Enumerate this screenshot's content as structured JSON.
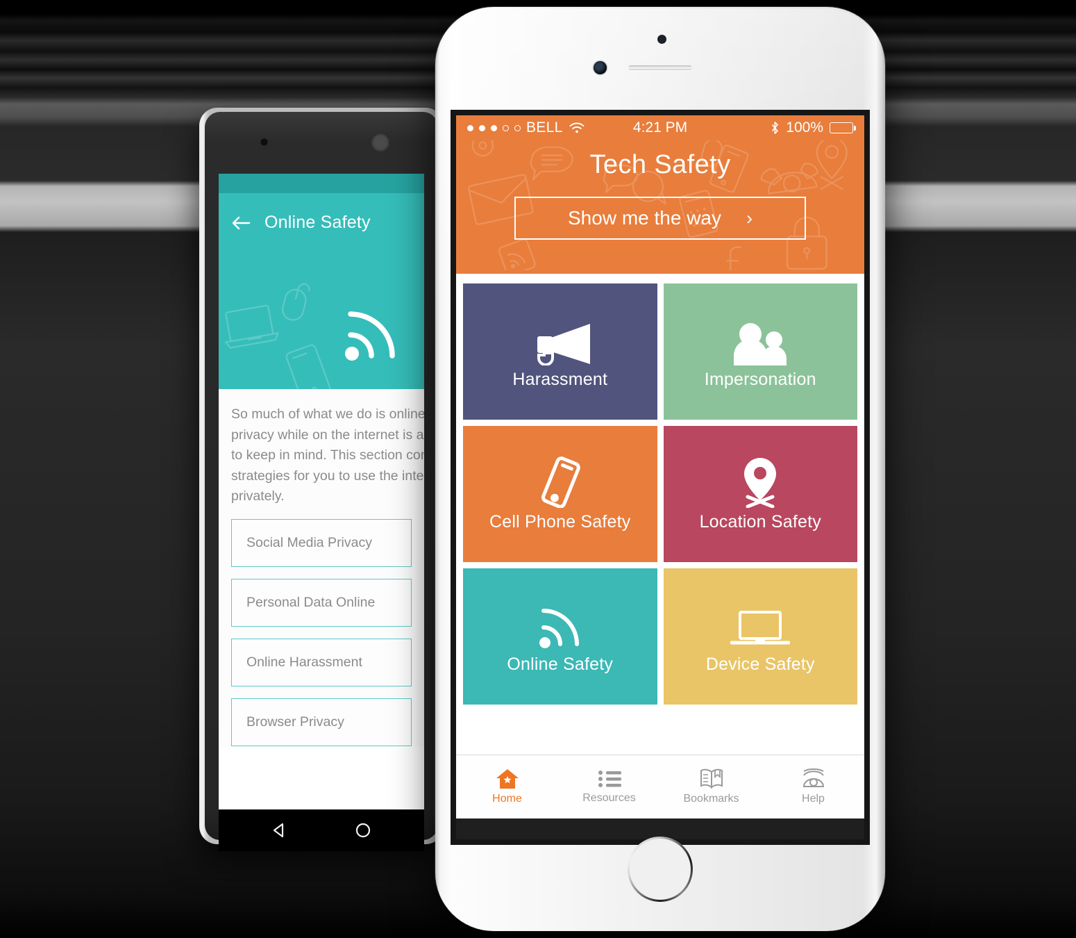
{
  "android": {
    "statusbar_color": "#26a3a0",
    "header_color": "#35bdb9",
    "back_icon": "back-arrow-icon",
    "title": "Online Safety",
    "hero_icon": "wifi-signal-icon",
    "intro_text": "So much of what we do is online.\nprivacy while on the internet is a\nto keep in mind. This section con\nstrategies for you to use the inter\nprivately.",
    "list_items": [
      {
        "label": "Social Media Privacy"
      },
      {
        "label": "Personal Data Online"
      },
      {
        "label": "Online Harassment"
      },
      {
        "label": "Browser Privacy"
      }
    ],
    "navbar": [
      {
        "icon": "android-back-triangle-icon"
      },
      {
        "icon": "android-home-circle-icon"
      }
    ]
  },
  "ios": {
    "statusbar": {
      "signal_filled": 3,
      "signal_empty": 2,
      "carrier": "BELL",
      "wifi_icon": "wifi-icon",
      "time": "4:21 PM",
      "bluetooth_icon": "bluetooth-icon",
      "battery_percent": "100%",
      "battery_level": 100
    },
    "header": {
      "accent_color": "#e87d3c",
      "app_title": "Tech Safety",
      "cta_label": "Show me the way",
      "cta_chevron": "chevron-right-icon"
    },
    "tiles": [
      {
        "label": "Harassment",
        "color": "#51547d",
        "icon": "megaphone-icon"
      },
      {
        "label": "Impersonation",
        "color": "#8cc299",
        "icon": "two-people-icon"
      },
      {
        "label": "Cell Phone Safety",
        "color": "#e87d3c",
        "icon": "cell-phone-icon"
      },
      {
        "label": "Location Safety",
        "color": "#b8475f",
        "icon": "location-pin-icon"
      },
      {
        "label": "Online Safety",
        "color": "#3cb8b5",
        "icon": "wifi-signal-icon"
      },
      {
        "label": "Device Safety",
        "color": "#e9c567",
        "icon": "laptop-icon"
      }
    ],
    "tabbar": [
      {
        "label": "Home",
        "icon": "home-star-icon",
        "active": true
      },
      {
        "label": "Resources",
        "icon": "list-icon",
        "active": false
      },
      {
        "label": "Bookmarks",
        "icon": "open-book-icon",
        "active": false
      },
      {
        "label": "Help",
        "icon": "telephone-icon",
        "active": false
      }
    ],
    "active_tab_color": "#ee7623"
  }
}
